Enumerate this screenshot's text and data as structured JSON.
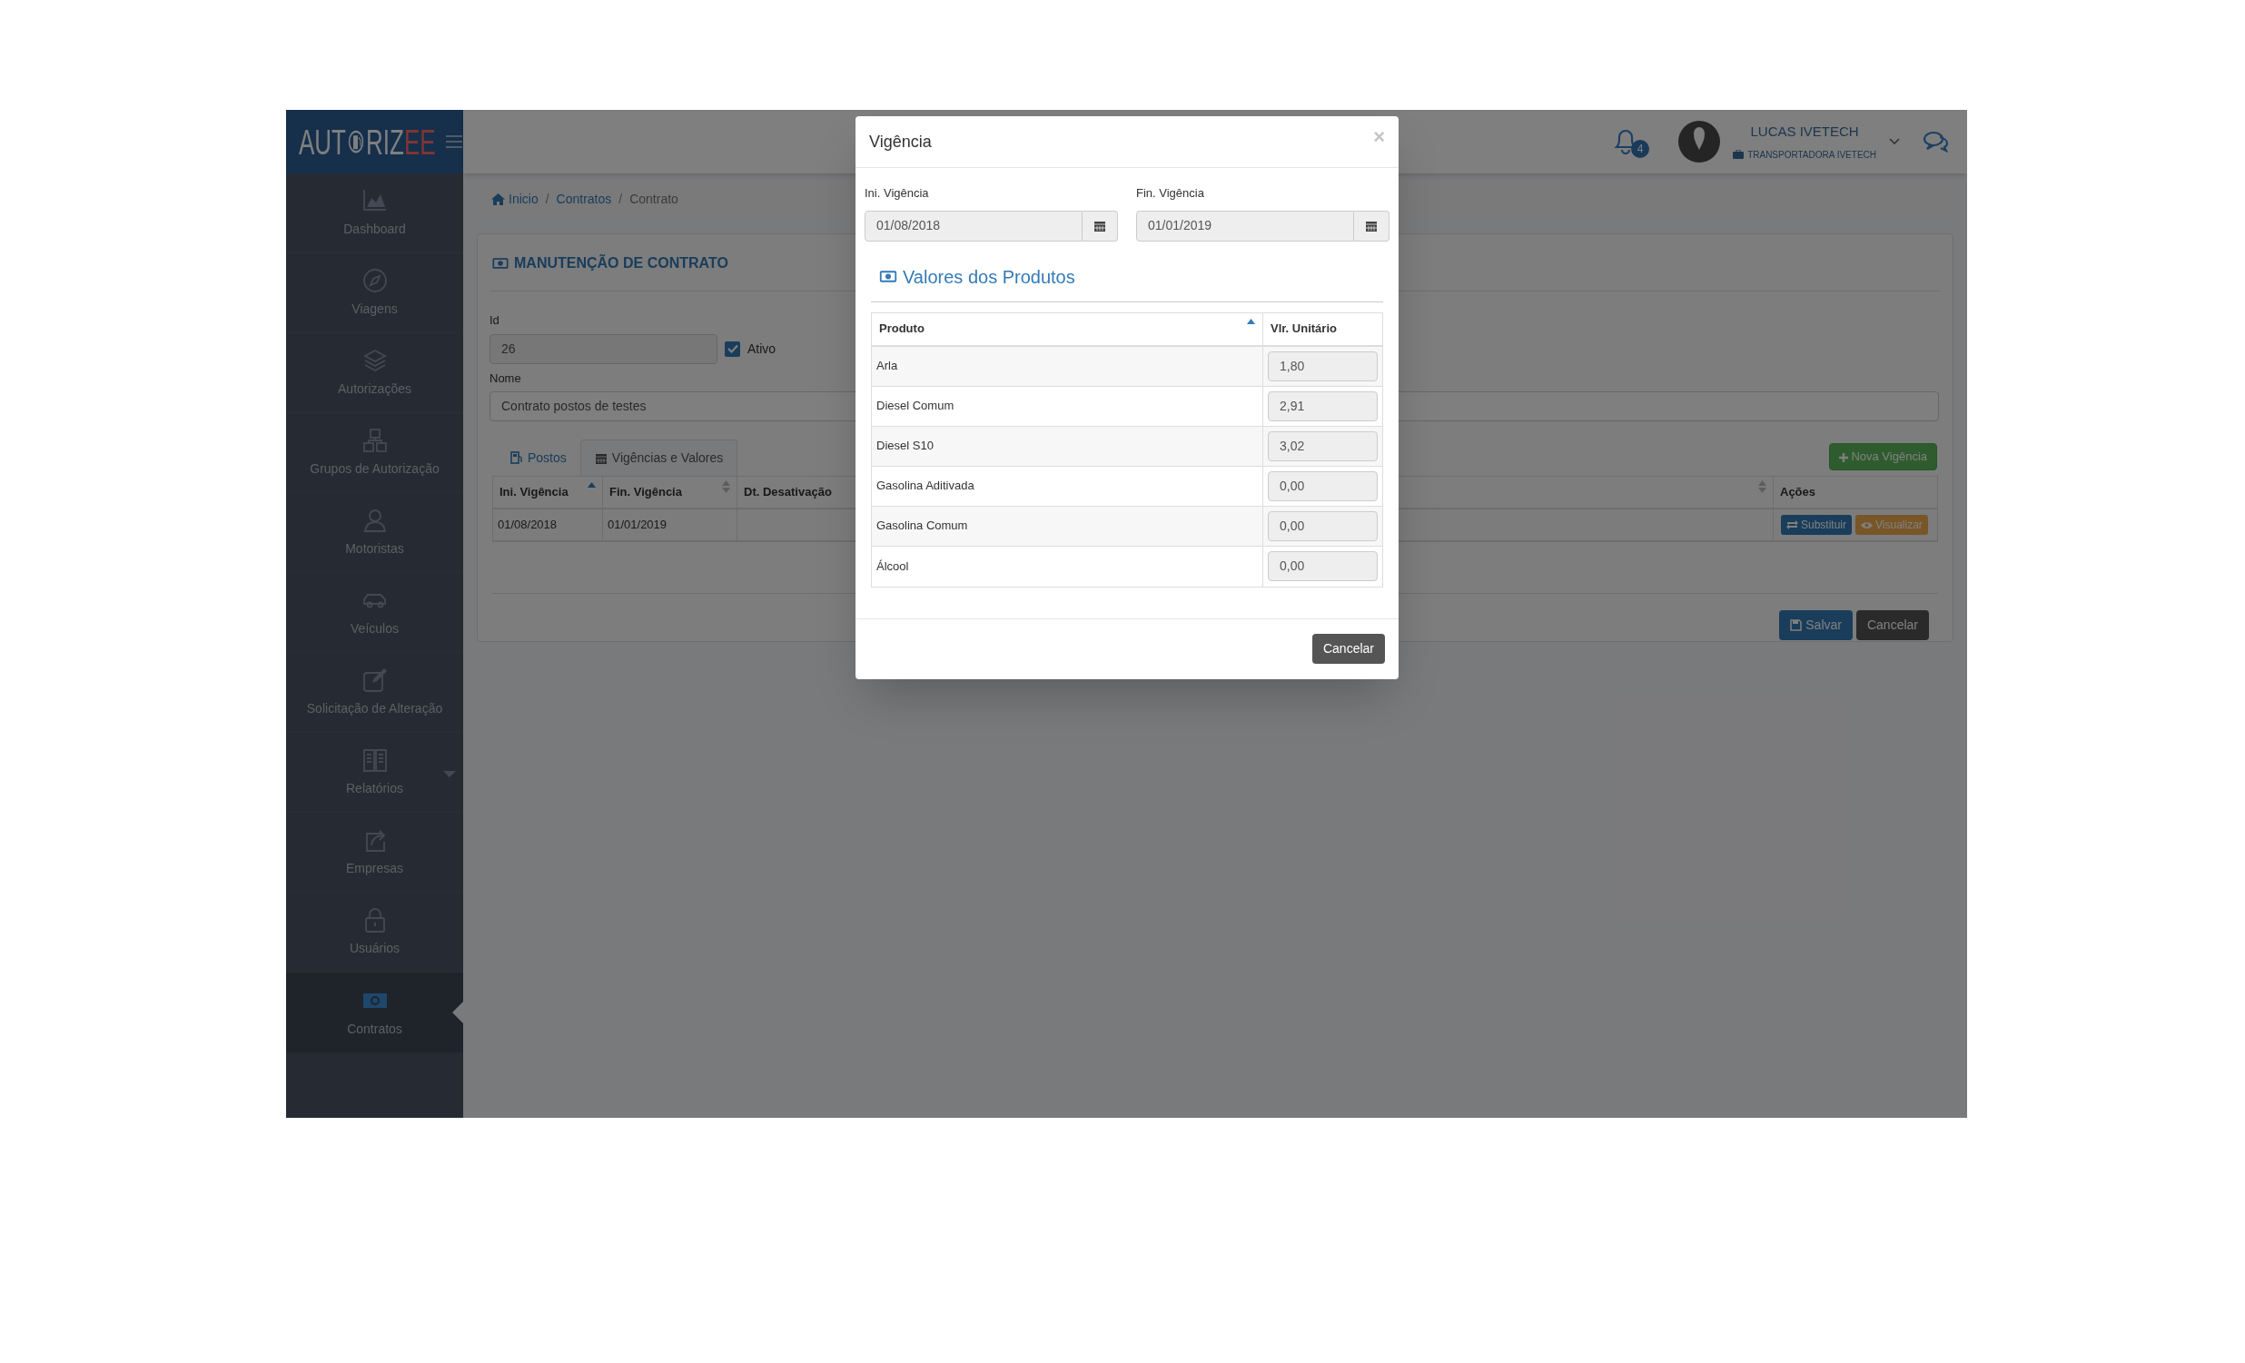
{
  "logo": {
    "start": "AUT",
    "end": "RIZ",
    "accent": "EE"
  },
  "sidebar": {
    "items": [
      {
        "label": "Dashboard",
        "selected": false,
        "has_submenu": false
      },
      {
        "label": "Viagens",
        "selected": false,
        "has_submenu": false
      },
      {
        "label": "Autorizações",
        "selected": false,
        "has_submenu": false
      },
      {
        "label": "Grupos de Autorização",
        "selected": false,
        "has_submenu": false
      },
      {
        "label": "Motoristas",
        "selected": false,
        "has_submenu": false
      },
      {
        "label": "Veículos",
        "selected": false,
        "has_submenu": false
      },
      {
        "label": "Solicitação de Alteração",
        "selected": false,
        "has_submenu": false
      },
      {
        "label": "Relatórios",
        "selected": false,
        "has_submenu": true
      },
      {
        "label": "Empresas",
        "selected": false,
        "has_submenu": false
      },
      {
        "label": "Usuários",
        "selected": false,
        "has_submenu": false
      },
      {
        "label": "Contratos",
        "selected": true,
        "has_submenu": false
      }
    ]
  },
  "header": {
    "notifications": "4",
    "user_name": "LUCAS IVETECH",
    "company": "TRANSPORTADORA IVETECH"
  },
  "breadcrumb": [
    {
      "label": "Inicio",
      "current": false
    },
    {
      "separator": "/",
      "label": "Contratos",
      "current": false
    },
    {
      "separator": "/",
      "label": "Contrato",
      "current": true
    }
  ],
  "form": {
    "title": "MANUTENÇÃO DE CONTRATO",
    "id_label": "Id",
    "id_value": "26",
    "active": {
      "label": "Ativo",
      "checked": true
    },
    "name_label": "Nome",
    "name_value": "Contrato postos de testes"
  },
  "tabs": [
    {
      "label": "Postos",
      "selected": false
    },
    {
      "label": "Vigências e Valores",
      "selected": true
    }
  ],
  "new_button": "Nova Vigência",
  "table": {
    "columns": [
      {
        "label": "Ini. Vigência",
        "sortable": true,
        "sorted": true
      },
      {
        "label": "Fin. Vigência",
        "sortable": true,
        "sorted": false
      },
      {
        "label": "Dt. Desativação",
        "sortable": false
      },
      {
        "sortable": true,
        "sorted": false
      },
      {
        "label": "Ações",
        "sortable": false
      }
    ],
    "rows": [
      {
        "start": "01/08/2018",
        "end": "01/01/2019",
        "actions": [
          {
            "label": "Substituir",
            "kind": "replace"
          },
          {
            "label": "Visualizar",
            "kind": "view"
          }
        ]
      }
    ]
  },
  "footer_buttons": [
    {
      "label": "Salvar",
      "kind": "primary"
    },
    {
      "label": "Cancelar",
      "kind": "dark"
    }
  ],
  "modal": {
    "title": "Vigência",
    "close": "×",
    "start_label": "Ini. Vigência",
    "start_value": "01/08/2018",
    "end_label": "Fin. Vigência",
    "end_value": "01/01/2019",
    "section_title": "Valores dos Produtos",
    "columns": [
      {
        "label": "Produto",
        "sortable": true,
        "sorted": true
      },
      {
        "label": "Vlr. Unitário",
        "sortable": false
      }
    ],
    "rows": [
      {
        "product": "Arla",
        "value": "1,80"
      },
      {
        "product": "Diesel Comum",
        "value": "2,91"
      },
      {
        "product": "Diesel S10",
        "value": "3,02"
      },
      {
        "product": "Gasolina Aditivada",
        "value": "0,00"
      },
      {
        "product": "Gasolina Comum",
        "value": "0,00"
      },
      {
        "product": "Álcool",
        "value": "0,00"
      }
    ],
    "cancel": "Cancelar"
  }
}
